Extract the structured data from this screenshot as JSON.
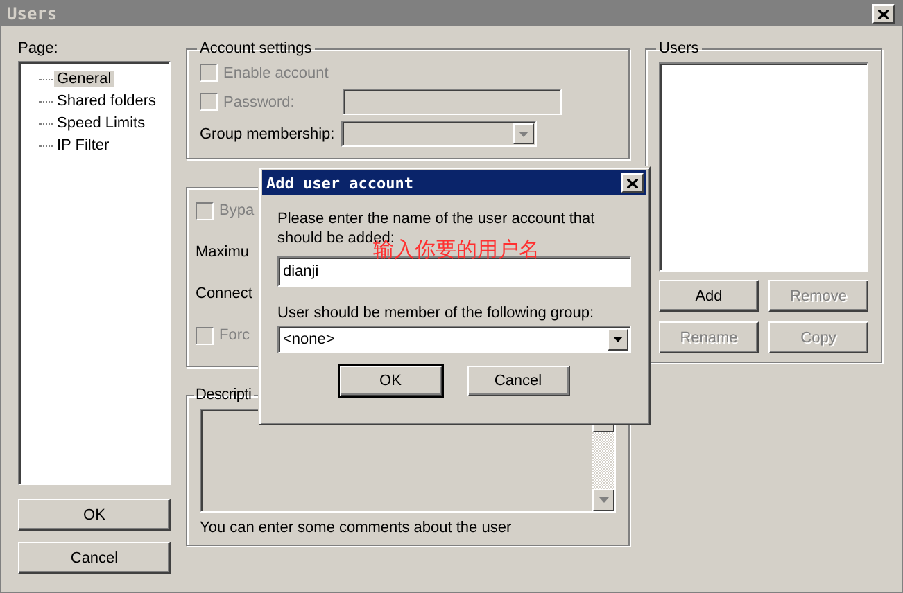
{
  "window": {
    "title": "Users"
  },
  "page_label": "Page:",
  "pages": [
    {
      "label": "General",
      "selected": true
    },
    {
      "label": "Shared folders",
      "selected": false
    },
    {
      "label": "Speed Limits",
      "selected": false
    },
    {
      "label": "IP Filter",
      "selected": false
    }
  ],
  "buttons": [
    "OK",
    "Cancel"
  ],
  "account_settings": {
    "title": "Account settings",
    "options": [
      {
        "kind": "checkbox",
        "label": "Enable account",
        "checked": false,
        "disabled": true
      },
      {
        "kind": "checkbox_field",
        "label": "Password:",
        "checked": false,
        "disabled": true
      }
    ],
    "group_label": "Group membership:"
  },
  "limits": {
    "options": [
      {
        "kind": "checkbox",
        "label": "Bypa",
        "checked": false,
        "disabled": true
      },
      {
        "kind": "text",
        "label": "Maximu"
      },
      {
        "kind": "text",
        "label": "Connect"
      },
      {
        "kind": "checkbox",
        "label": "Forc",
        "checked": false,
        "disabled": true
      }
    ]
  },
  "description": {
    "title": "Descripti",
    "hint": "You can enter some comments about the user"
  },
  "users": {
    "title": "Users",
    "buttons": [
      {
        "label": "Add",
        "disabled": false
      },
      {
        "label": "Remove",
        "disabled": true
      },
      {
        "label": "Rename",
        "disabled": true
      },
      {
        "label": "Copy",
        "disabled": true
      }
    ]
  },
  "dialog": {
    "title": "Add user account",
    "prompt": "Please enter the name of the user account that should be added:",
    "annotation": "输入你要的用户名",
    "name_value": "dianji",
    "group_label": "User should be member of the following group:",
    "group_value": "<none>",
    "buttons": [
      {
        "label": "OK",
        "default": true
      },
      {
        "label": "Cancel",
        "default": false
      }
    ]
  }
}
